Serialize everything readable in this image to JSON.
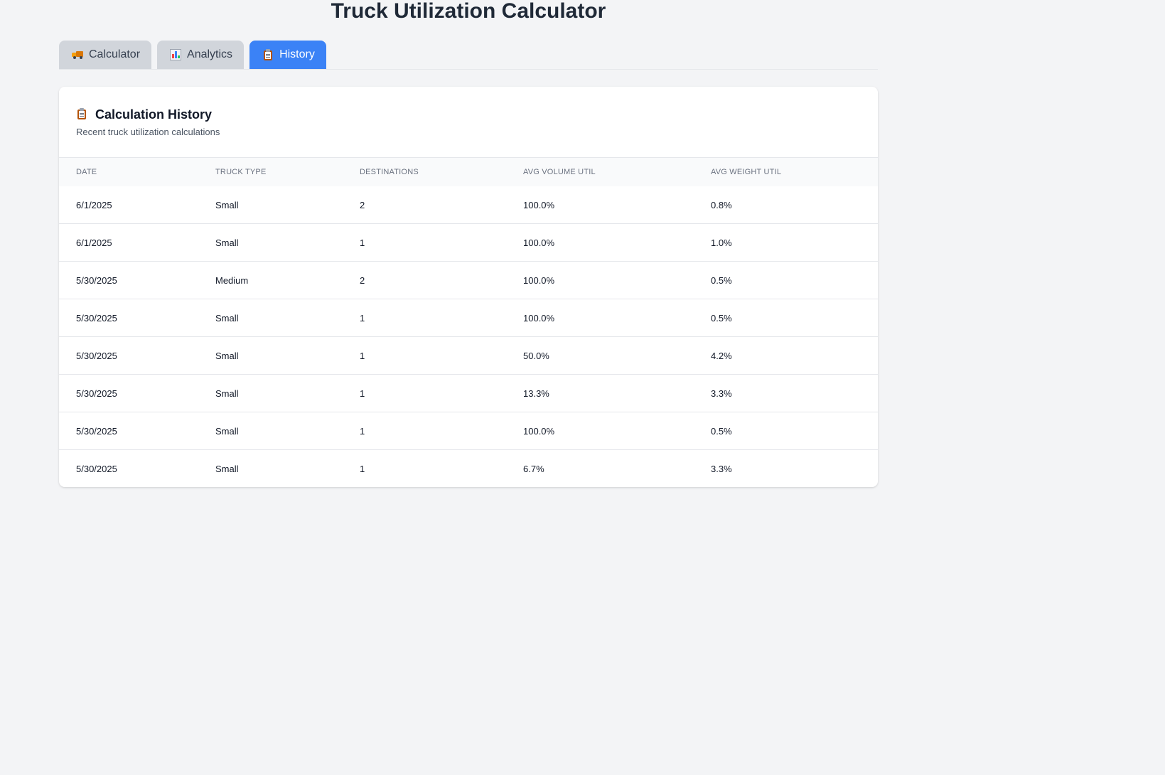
{
  "app": {
    "title": "Truck Utilization Calculator"
  },
  "tabs": [
    {
      "label": "Calculator",
      "icon": "truck-icon",
      "active": false
    },
    {
      "label": "Analytics",
      "icon": "bar-chart-icon",
      "active": false
    },
    {
      "label": "History",
      "icon": "clipboard-icon",
      "active": true
    }
  ],
  "history": {
    "title": "Calculation History",
    "subtitle": "Recent truck utilization calculations",
    "columns": [
      "Date",
      "Truck Type",
      "Destinations",
      "Avg Volume Util",
      "Avg Weight Util"
    ],
    "rows": [
      {
        "date": "6/1/2025",
        "truck_type": "Small",
        "destinations": "2",
        "avg_volume_util": "100.0%",
        "avg_weight_util": "0.8%"
      },
      {
        "date": "6/1/2025",
        "truck_type": "Small",
        "destinations": "1",
        "avg_volume_util": "100.0%",
        "avg_weight_util": "1.0%"
      },
      {
        "date": "5/30/2025",
        "truck_type": "Medium",
        "destinations": "2",
        "avg_volume_util": "100.0%",
        "avg_weight_util": "0.5%"
      },
      {
        "date": "5/30/2025",
        "truck_type": "Small",
        "destinations": "1",
        "avg_volume_util": "100.0%",
        "avg_weight_util": "0.5%"
      },
      {
        "date": "5/30/2025",
        "truck_type": "Small",
        "destinations": "1",
        "avg_volume_util": "50.0%",
        "avg_weight_util": "4.2%"
      },
      {
        "date": "5/30/2025",
        "truck_type": "Small",
        "destinations": "1",
        "avg_volume_util": "13.3%",
        "avg_weight_util": "3.3%"
      },
      {
        "date": "5/30/2025",
        "truck_type": "Small",
        "destinations": "1",
        "avg_volume_util": "100.0%",
        "avg_weight_util": "0.5%"
      },
      {
        "date": "5/30/2025",
        "truck_type": "Small",
        "destinations": "1",
        "avg_volume_util": "6.7%",
        "avg_weight_util": "3.3%"
      }
    ]
  },
  "colors": {
    "background": "#f3f4f6",
    "accent": "#3b82f6",
    "tab_inactive": "#d1d5db",
    "card": "#ffffff"
  }
}
